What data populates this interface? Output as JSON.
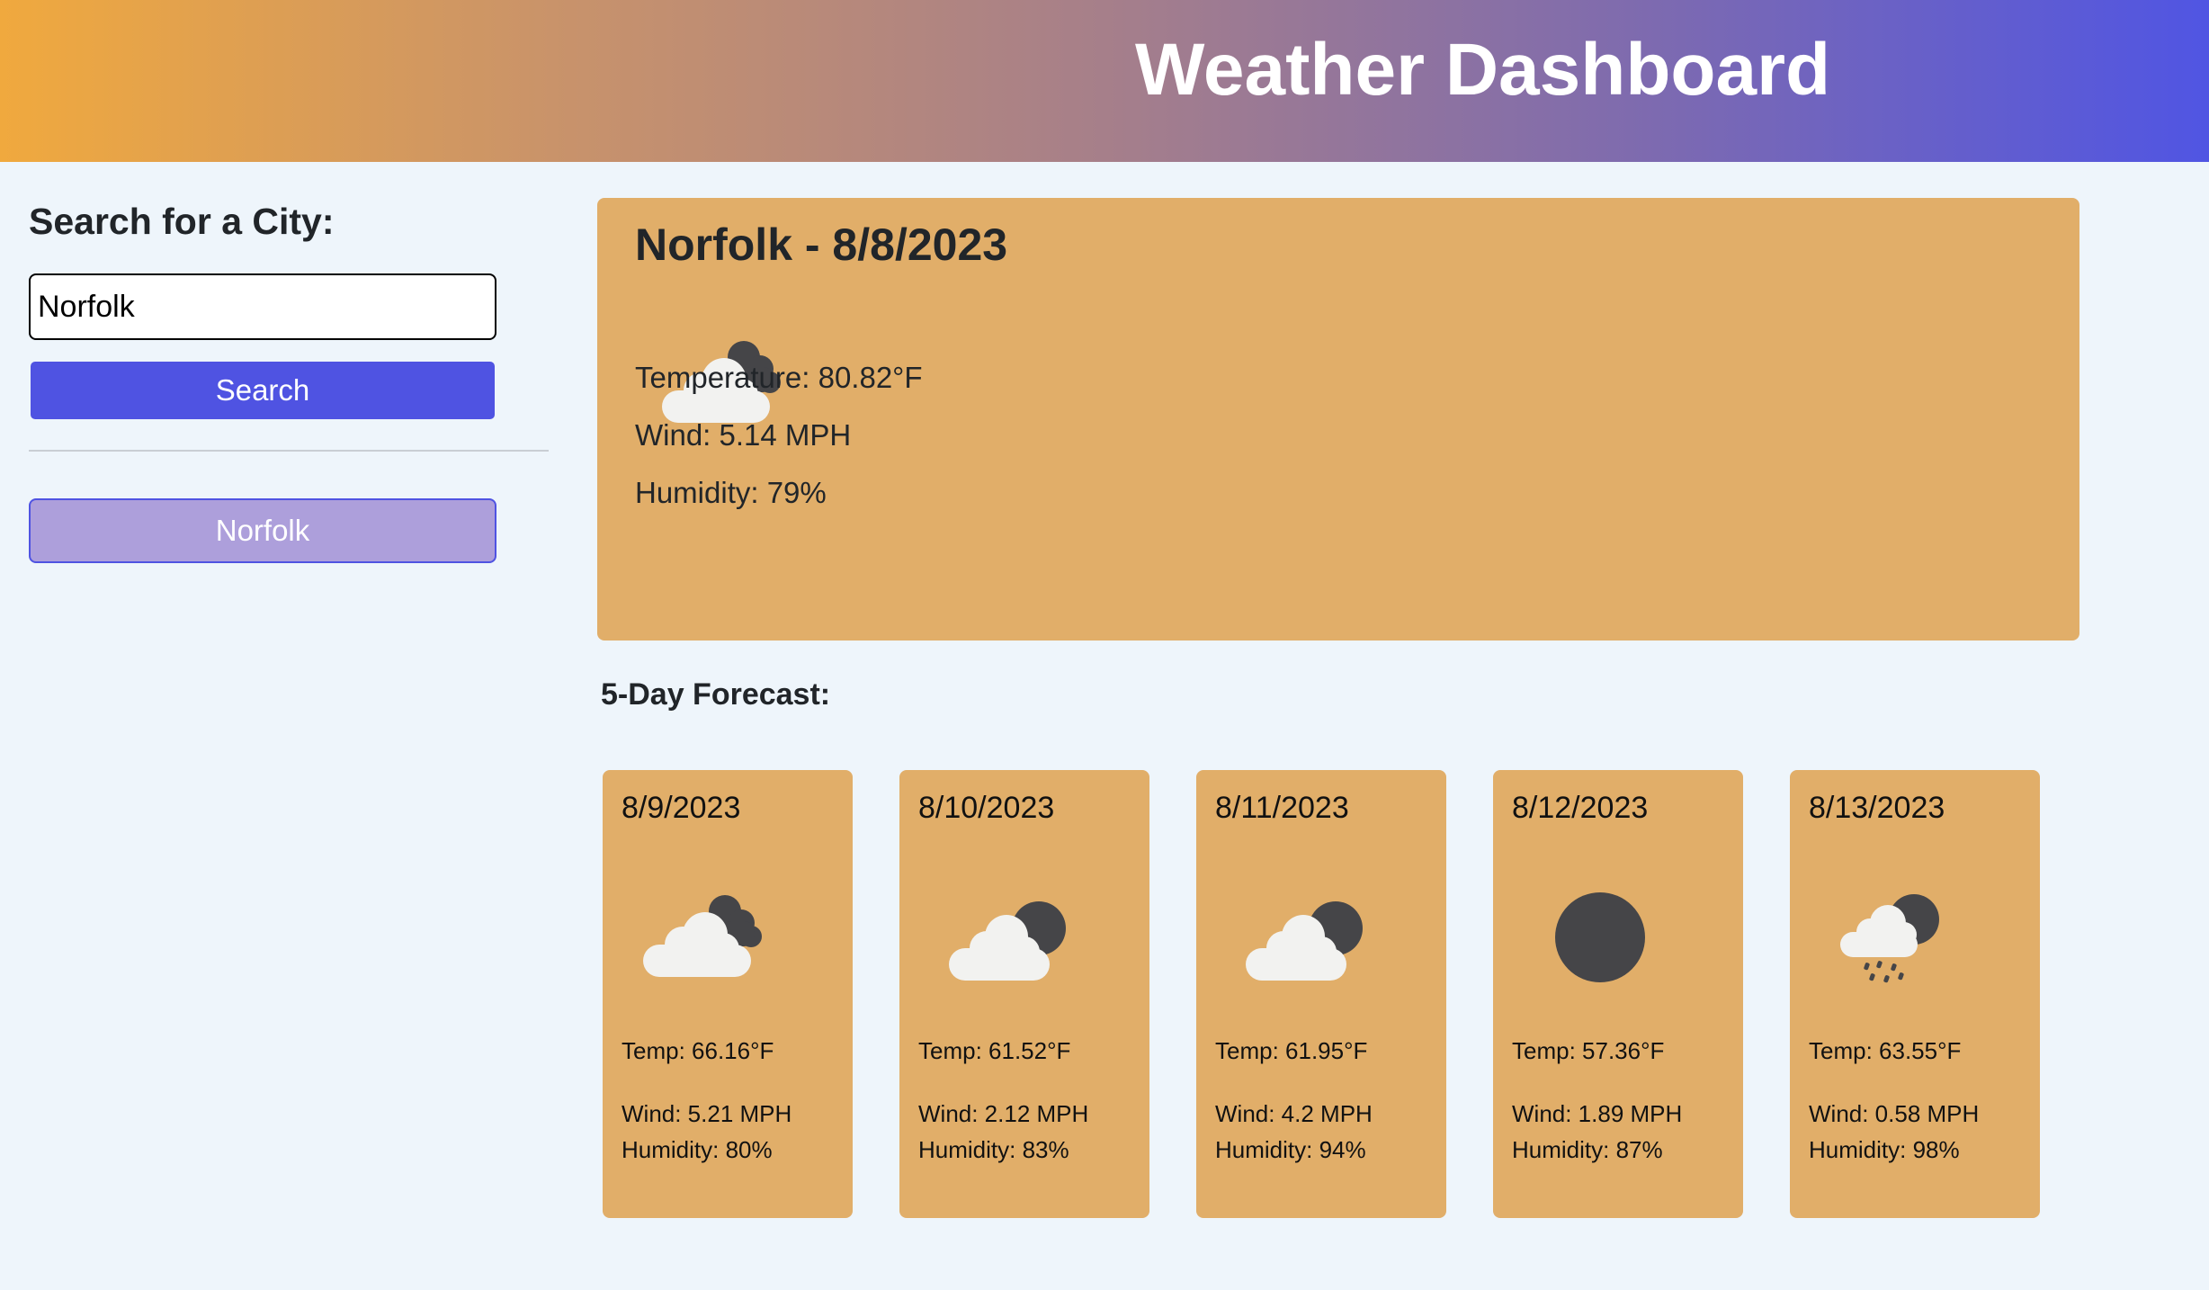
{
  "header": {
    "title": "Weather Dashboard",
    "gradient_colors": [
      "#f0a93e",
      "#5055e3"
    ]
  },
  "sidebar": {
    "heading": "Search for a City:",
    "search_input_value": "Norfolk",
    "search_button_label": "Search",
    "history": [
      {
        "label": "Norfolk"
      }
    ]
  },
  "current": {
    "title": "Norfolk - 8/8/2023",
    "icon": "broken-clouds-icon",
    "temperature": "Temperature: 80.82°F",
    "wind": "Wind: 5.14 MPH",
    "humidity": "Humidity: 79%"
  },
  "forecast": {
    "heading": "5-Day Forecast:",
    "days": [
      {
        "date": "8/9/2023",
        "icon": "broken-clouds-icon",
        "temp": "Temp: 66.16°F",
        "wind": "Wind: 5.21 MPH",
        "humidity": "Humidity: 80%"
      },
      {
        "date": "8/10/2023",
        "icon": "few-clouds-night-icon",
        "temp": "Temp: 61.52°F",
        "wind": "Wind: 2.12 MPH",
        "humidity": "Humidity: 83%"
      },
      {
        "date": "8/11/2023",
        "icon": "few-clouds-night-icon",
        "temp": "Temp: 61.95°F",
        "wind": "Wind: 4.2 MPH",
        "humidity": "Humidity: 94%"
      },
      {
        "date": "8/12/2023",
        "icon": "clear-night-icon",
        "temp": "Temp: 57.36°F",
        "wind": "Wind: 1.89 MPH",
        "humidity": "Humidity: 87%"
      },
      {
        "date": "8/13/2023",
        "icon": "rain-night-icon",
        "temp": "Temp: 63.55°F",
        "wind": "Wind: 0.58 MPH",
        "humidity": "Humidity: 98%"
      }
    ]
  },
  "colors": {
    "page_background": "#eef5fb",
    "card_background": "#e1ae69",
    "search_button": "#4f53e2",
    "history_button": "#ad9fdb",
    "icon_dark": "#454548",
    "icon_cloud": "#f2f2f0"
  }
}
